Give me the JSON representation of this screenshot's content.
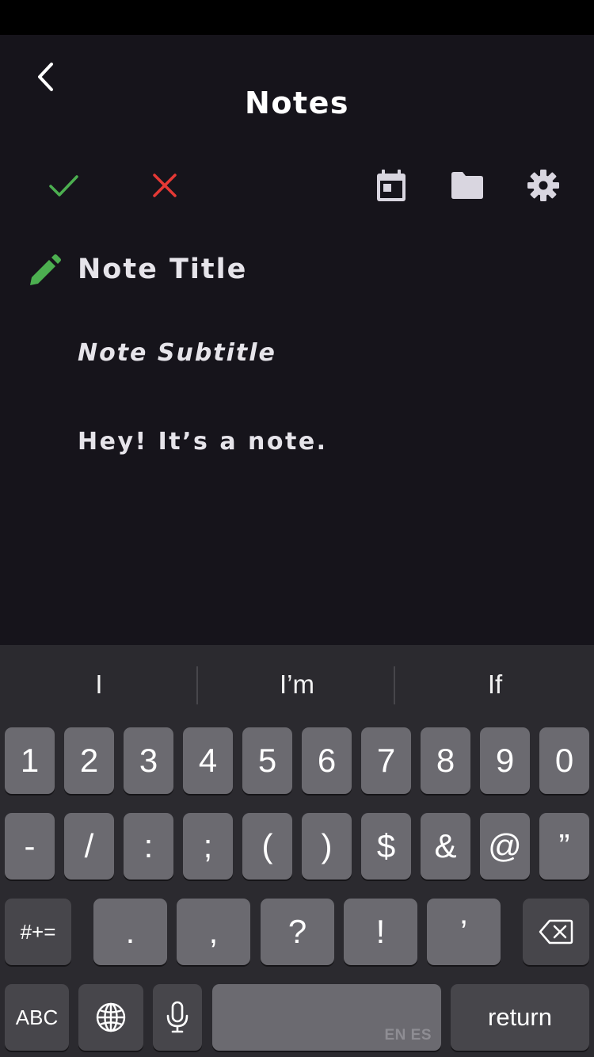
{
  "nav": {
    "title": "Notes"
  },
  "colors": {
    "background": "#16141b",
    "accent_green": "#4caf50",
    "danger_red": "#e53935",
    "icon_gray": "#d9d6e0"
  },
  "toolbar": {
    "icons": [
      "check-icon",
      "close-icon",
      "calendar-icon",
      "folder-icon",
      "gear-icon"
    ]
  },
  "note": {
    "title": "Note Title",
    "subtitle": "Note Subtitle",
    "body": "Hey! It’s a note."
  },
  "keyboard": {
    "suggestions": [
      "I",
      "I’m",
      "If"
    ],
    "row1": [
      "1",
      "2",
      "3",
      "4",
      "5",
      "6",
      "7",
      "8",
      "9",
      "0"
    ],
    "row2": [
      "-",
      "/",
      ":",
      ";",
      "(",
      ")",
      "$",
      "&",
      "@",
      "”"
    ],
    "row3": [
      "#+=",
      ".",
      ",",
      "?",
      "!",
      "’"
    ],
    "abc_label": "ABC",
    "space_lang": "EN ES",
    "return_label": "return"
  }
}
